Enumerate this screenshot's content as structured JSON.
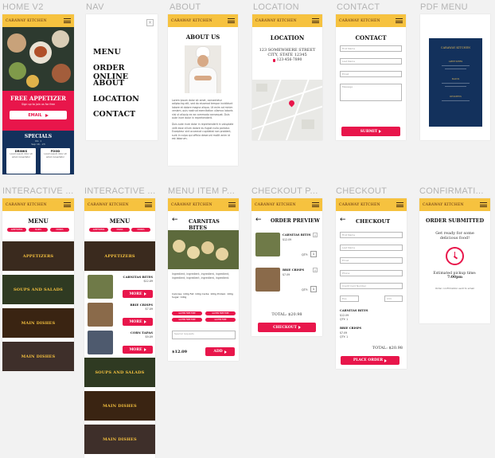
{
  "colors": {
    "accent": "#e8164b",
    "header": "#f6c23f",
    "navy": "#13315c",
    "dark": "#2a2a2a"
  },
  "labels": {
    "home": "HOME V2",
    "nav": "NAV",
    "about": "ABOUT",
    "location": "LOCATION",
    "contact": "CONTACT",
    "pdf": "PDF MENU",
    "int1": "INTERACTIVE ...",
    "int2": "INTERACTIVE ...",
    "item": "MENU ITEM P...",
    "checkout_p": "CHECKOUT P...",
    "checkout": "CHECKOUT",
    "confirm": "CONFIRMATI..."
  },
  "brand": "CARAWAY KITCHEN",
  "home": {
    "free_title": "FREE APPETIZER",
    "free_sub": "Sign up to join us for free",
    "email_btn": "EMAIL",
    "specials_title": "SPECIALS",
    "specials_sub1": "Vol. 1",
    "specials_sub2": "Sep 16 - 23",
    "card1_title": "DRINKS",
    "card1_text": "Lorem ipsum dolor sit amet consectetur",
    "card2_title": "FOOD",
    "card2_text": "Lorem ipsum dolor sit amet consectetur"
  },
  "nav": {
    "items": [
      "MENU",
      "ORDER ONLINE",
      "ABOUT",
      "LOCATION",
      "CONTACT"
    ]
  },
  "about": {
    "title": "ABOUT US",
    "p1": "Lorem ipsum dolor sit amet, consectetur adipiscing elit, sed do eiusmod tempor incididunt labore et dolore magna aliqua. Ut enim ad minim veniam, quis nostrud exercitation ullamco laboris nisi ut aliquip ex ea commodo consequat. Duis aute irure dolor in reprehenderit.",
    "p2": "Duis aute irure dolor in reprehenderit in voluptate velit esse cillum dolore eu fugiat nulla pariatur. Excepteur sint occaecat cupidatat non proident, sunt in culpa qui officia deserunt mollit anim id est laborum."
  },
  "location": {
    "title": "LOCATION",
    "addr1": "123 SOMEWHERE STREET",
    "addr2": "CITY, STATE 12345",
    "phone": "123-456-7890"
  },
  "contact": {
    "title": "CONTACT",
    "f1": "First Name",
    "f2": "Last Name",
    "f3": "Email",
    "f4": "Message",
    "submit": "SUBMIT"
  },
  "pdf": {
    "brand": "CARAWAY KITCHEN",
    "s1": "APPETIZERS",
    "s2": "MAINS",
    "s3": "DESSERTS"
  },
  "interactive": {
    "menu": "MENU",
    "pills": [
      "APPETIZERS",
      "MAINS",
      "DRINKS"
    ],
    "cats": [
      "APPETIZERS",
      "SOUPS AND SALADS",
      "MAIN DISHES",
      "MAIN DISHES"
    ]
  },
  "interactive2": {
    "menu": "MENU",
    "pills": [
      "APPETIZERS",
      "MAINS",
      "DRINKS"
    ],
    "appetizers": "APPETIZERS",
    "item1": "CARNITAS BITES",
    "price1": "$12.09",
    "item2": "BRIE CRISPS",
    "price2": "$7.09",
    "item3": "CORN TAPAS",
    "price3": "$9.09",
    "more": "MORE",
    "cats": [
      "SOUPS AND SALADS",
      "MAIN DISHES",
      "MAIN DISHES"
    ]
  },
  "item": {
    "title": "CARNITAS BITES",
    "desc": "Ingredient, ingredient, ingredient, ingredient, ingredient, ingredient, ingredient, ingredient.",
    "nutrition": "Calories: 100g  Fat: 100g  Carbs: 100g  Protein: 100g  Sugar: 100g",
    "pills": [
      "GLUTEN FREE FREE",
      "GLUTEN FREE FREE",
      "GLUTEN FREE FREE",
      "GLUTEN FREE"
    ],
    "note_ph": "Special requests",
    "price": "$12.09",
    "add": "ADD"
  },
  "preview": {
    "title": "ORDER PREVIEW",
    "item1": "CARNITAS BITES",
    "p1": "$12.09",
    "item2": "BRIE CRISPS",
    "p2": "$7.09",
    "qty": "QTY:",
    "q1": "1",
    "q2": "1",
    "total": "TOTAL: $20.98",
    "checkout": "CHECKOUT"
  },
  "checkout": {
    "title": "CHECKOUT",
    "fields": [
      "First Name",
      "Last Name",
      "Email",
      "Phone",
      "Credit Card Number",
      "Exp",
      "CVV"
    ],
    "item1": "CARNITAS BITES",
    "p1": "$12.09",
    "q1": "QTY: 1",
    "item2": "BRIE CRISPS",
    "p2": "$7.09",
    "q2": "QTY: 1",
    "total": "TOTAL: $20.98",
    "place": "PLACE ORDER"
  },
  "confirm": {
    "title": "ORDER SUBMITTED",
    "text1": "Get ready for some",
    "text2": "delicious food!",
    "est": "Estimated pickup time:",
    "time": "7:00pm",
    "note": "Order confirmation sent to email"
  }
}
